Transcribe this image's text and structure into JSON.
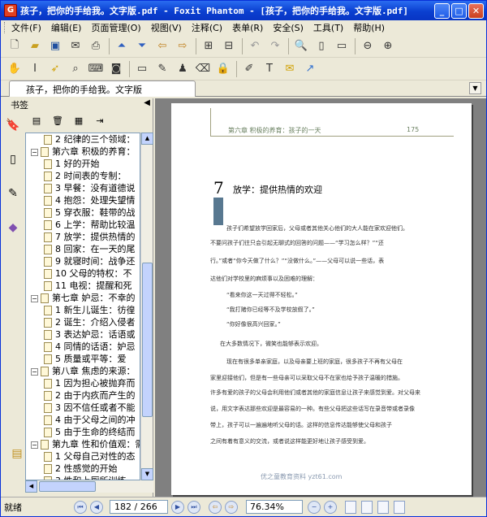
{
  "window": {
    "title": "孩子，把你的手给我。文字版.pdf - Foxit Phantom - [孩子，把你的手给我。文字版.pdf]",
    "minimize": "_",
    "maximize": "□",
    "close": "✕"
  },
  "menu": [
    "文件(F)",
    "编辑(E)",
    "页面管理(O)",
    "视图(V)",
    "注释(C)",
    "表单(R)",
    "安全(S)",
    "工具(T)",
    "帮助(H)"
  ],
  "tab": {
    "label": "孩子，把你的手给我。文字版"
  },
  "panel": {
    "title": "书签"
  },
  "bookmarks": [
    {
      "text": "2  纪律的三个领域：",
      "level": 2
    },
    {
      "text": "第六章    积极的养育：",
      "level": 1,
      "expand": "−"
    },
    {
      "text": "1  好的开始",
      "level": 2
    },
    {
      "text": "2  时间表的专制：",
      "level": 2
    },
    {
      "text": "3  早餐：没有道德说",
      "level": 2
    },
    {
      "text": "4  抱怨：处理失望情",
      "level": 2
    },
    {
      "text": "5  穿衣服：鞋带的战",
      "level": 2
    },
    {
      "text": "6  上学：帮助比较温",
      "level": 2
    },
    {
      "text": "7  放学：提供热情的",
      "level": 2
    },
    {
      "text": "8  回家：在一天的尾",
      "level": 2
    },
    {
      "text": "9  就寝时间：战争还",
      "level": 2
    },
    {
      "text": "10  父母的特权：不",
      "level": 2
    },
    {
      "text": "11  电视：提醒和死",
      "level": 2
    },
    {
      "text": "第七章  妒忌：不幸的",
      "level": 1,
      "expand": "−"
    },
    {
      "text": "1  新生儿诞生：彷徨",
      "level": 2
    },
    {
      "text": "2  诞生：介绍入侵者",
      "level": 2
    },
    {
      "text": "3  表达妒忌：话语或",
      "level": 2
    },
    {
      "text": "4  同情的话语：妒忌",
      "level": 2
    },
    {
      "text": "5  质量或平等：爱",
      "level": 2
    },
    {
      "text": "第八章    焦虑的来源：",
      "level": 1,
      "expand": "−"
    },
    {
      "text": "1  因为担心被抛弃而",
      "level": 2
    },
    {
      "text": "2  由于内疚而产生的",
      "level": 2
    },
    {
      "text": "3  因不信任或者不能",
      "level": 2
    },
    {
      "text": "4  由于父母之间的冲",
      "level": 2
    },
    {
      "text": "5  由于生命的终结而",
      "level": 2
    },
    {
      "text": "第九章  性和价值观：需要",
      "level": 1,
      "expand": "−"
    },
    {
      "text": "1  父母自己对性的态",
      "level": 2
    },
    {
      "text": "2  性感觉的开始",
      "level": 2
    },
    {
      "text": "3  性和上厕所训练",
      "level": 2
    }
  ],
  "page": {
    "header": "第六章  积极的养育：孩子的一天",
    "page_number": "175",
    "chapter_number": "7",
    "chapter_title": "放学：提供热情的欢迎",
    "paragraphs": [
      "孩子们希望放学回家后，父母或者其他关心他们的大人能在家欢迎他们。",
      "不要问孩子们往只会引起无聊式的回答的问题——“学习怎么样？”“还",
      "行。”或者“你今天做了什么？”“没做什么。”——父母可以说一些话，表",
      "达他们对学校里的麻烦事以及困难的理解：",
      "“看来你这一天过得不轻松。”",
      "“我打赌你已经等不及学校放假了。”",
      "“你好像很高兴回家。”",
      "在大多数情况下，微笑也能够表示欢迎。",
      "现在有很多单亲家庭，以及母亲要上班的家庭，很多孩子不再有父母在",
      "家里迎接他们，但是有一些母亲可以采取父母不在家也给予孩子温暖的措施。",
      "许多有爱的孩子的父母会利用他们或者其他的家庭信息让孩子来感觉到爱。对父母来",
      "说，用文字表达那些欢迎是最容易的一种。有些父母把这些话写在录音带或者录像",
      "带上，孩子可以一遍遍地听父母的话。这样的信息传达能够使父母和孩子",
      "之间有着有意义的交流，或者说这样能更好地让孩子感受到爱。"
    ],
    "watermark": "优之童教育资料   yzt61.com"
  },
  "status": {
    "text": "就绪",
    "page": "182 / 266",
    "zoom": "76.34%"
  }
}
